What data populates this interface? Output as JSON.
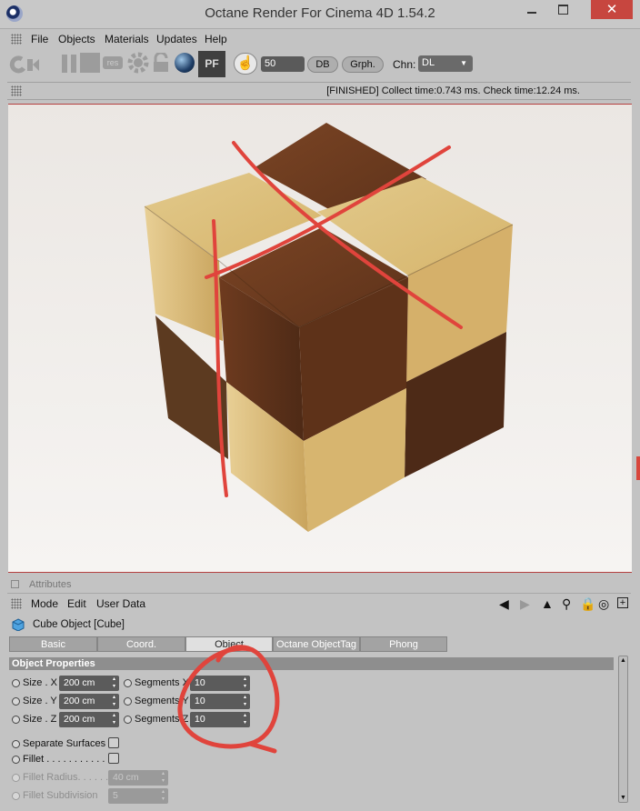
{
  "window": {
    "title": "Octane Render For Cinema 4D 1.54.2",
    "close_glyph": "✕"
  },
  "menu": {
    "items": [
      "File",
      "Objects",
      "Materials",
      "Updates",
      "Help"
    ]
  },
  "toolbar": {
    "icons": [
      "play-icon",
      "pause-icon",
      "stop-icon",
      "res-icon",
      "gear-icon",
      "lock-icon",
      "sphere-icon",
      "pf-icon",
      "hand-icon"
    ],
    "res_label": "res",
    "pf_label": "PF",
    "samples_value": "50",
    "db_label": "DB",
    "graph_label": "Grph.",
    "channel_label": "Chn:",
    "channel_value": "DL"
  },
  "status": {
    "text": "[FINISHED] Collect time:0.743 ms.  Check time:12.24 ms."
  },
  "attributes": {
    "header": "Attributes",
    "menu": [
      "Mode",
      "Edit",
      "User Data"
    ],
    "object_name": "Cube Object [Cube]",
    "tabs": [
      "Basic",
      "Coord.",
      "Object",
      "Octane ObjectTag",
      "Phong"
    ],
    "active_tab": "Object",
    "section_title": "Object Properties",
    "size_x_label": "Size . X",
    "size_x": "200 cm",
    "size_y_label": "Size . Y",
    "size_y": "200 cm",
    "size_z_label": "Size . Z",
    "size_z": "200 cm",
    "seg_x_label": "Segments X",
    "seg_x": "10",
    "seg_y_label": "Segments Y",
    "seg_y": "10",
    "seg_z_label": "Segments Z",
    "seg_z": "10",
    "separate_surfaces_label": "Separate Surfaces",
    "fillet_label": "Fillet . . . . . . . . . . . .",
    "fillet_radius_label": "Fillet Radius. . . . . .",
    "fillet_radius": "40 cm",
    "fillet_subdivision_label": "Fillet Subdivision",
    "fillet_subdivision": "5"
  },
  "colors": {
    "accent_red": "#e0443c",
    "panel": "#c3c3c3",
    "field": "#5a5a5a"
  }
}
